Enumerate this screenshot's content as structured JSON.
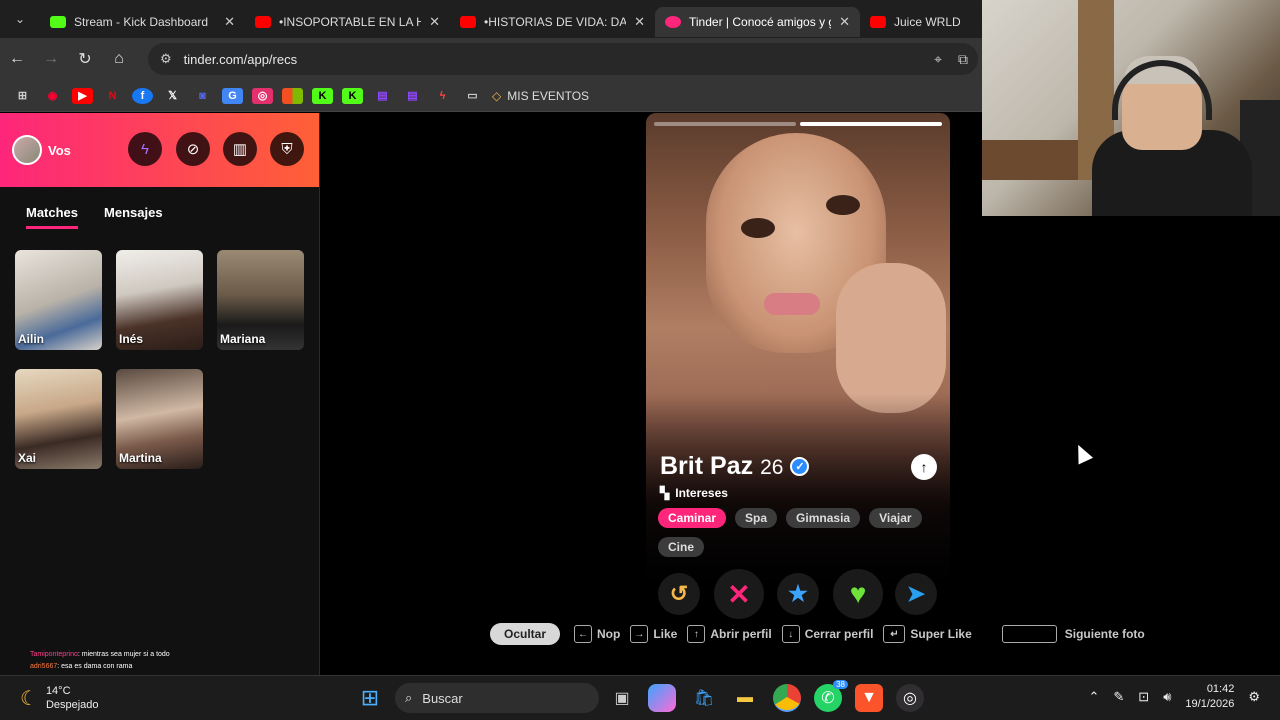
{
  "browser": {
    "tabs": [
      {
        "title": "Stream - Kick Dashboard",
        "favicon_color": "#53fc18",
        "active": false
      },
      {
        "title": "•INSOPORTABLE EN LA HEL",
        "favicon_color": "#ff0000",
        "active": false
      },
      {
        "title": "•HISTORIAS DE VIDA: DANIE",
        "favicon_color": "#ff0000",
        "active": false
      },
      {
        "title": "Tinder | Conocé amigos y g",
        "favicon_color": "#fd267a",
        "active": true
      },
      {
        "title": "Juice WRLD - Too",
        "favicon_color": "#ff0000",
        "active": false
      }
    ],
    "url": "tinder.com/app/recs",
    "bookmarks_folder_label": "MIS EVENTOS"
  },
  "sidebar": {
    "profile_label": "Vos",
    "tabs": [
      "Matches",
      "Mensajes"
    ],
    "matches": [
      "Ailin",
      "Inés",
      "Mariana",
      "Xai",
      "Martina"
    ],
    "chat": [
      {
        "user": "Tamiponteprino",
        "text": ": mientras sea mujer si a todo"
      },
      {
        "user": "adri5667",
        "text": ": esa es dama con rama"
      }
    ]
  },
  "card": {
    "name": "Brit Paz",
    "age": "26",
    "interests_title": "Intereses",
    "interests": [
      "Caminar",
      "Spa",
      "Gimnasia",
      "Viajar",
      "Cine"
    ],
    "highlighted_interest": "Caminar",
    "photo_count": 2,
    "current_photo": 1
  },
  "hints": {
    "hide_label": "Ocultar",
    "nope": "Nop",
    "like": "Like",
    "open_profile": "Abrir perfil",
    "close_profile": "Cerrar perfil",
    "super_like": "Super Like",
    "next_photo": "Siguiente foto"
  },
  "taskbar": {
    "temperature": "14°C",
    "weather": "Despejado",
    "search_placeholder": "Buscar",
    "whatsapp_badge": "38",
    "time": "01:42",
    "date": "19/1/2026"
  },
  "colors": {
    "tinder_gradient_start": "#fd267a",
    "tinder_gradient_end": "#ff6036",
    "rewind": "#f5b748",
    "nope": "#fd267a",
    "super_like": "#3ca4ff",
    "like": "#6ee13b",
    "boost": "#2a9ff0"
  }
}
